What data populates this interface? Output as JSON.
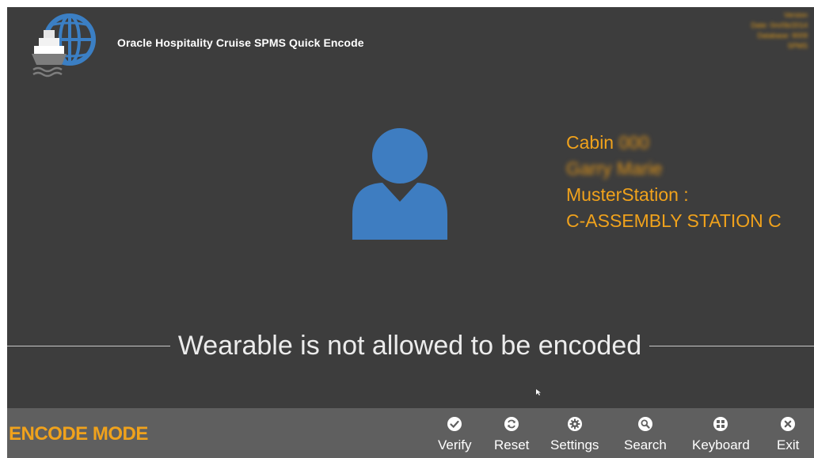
{
  "app": {
    "title": "Oracle Hospitality Cruise SPMS Quick Encode",
    "logo_icon": "globe-ship-icon"
  },
  "version_info": {
    "lines": [
      "Version",
      "Date: 0m/0b/2014",
      "Database: 9009",
      "SPMS"
    ]
  },
  "guest": {
    "avatar_icon": "person-icon",
    "cabin_label": "Cabin",
    "cabin_number": "000",
    "name": "Garry Marie",
    "muster_label": "MusterStation :",
    "muster_station": "C-ASSEMBLY STATION C"
  },
  "status": {
    "message": "Wearable is not allowed to be encoded"
  },
  "footer": {
    "mode_label": "ENCODE MODE",
    "tools": [
      {
        "label": "Verify",
        "icon": "check-circle-icon"
      },
      {
        "label": "Reset",
        "icon": "refresh-icon"
      },
      {
        "label": "Settings",
        "icon": "gear-icon"
      },
      {
        "label": "Search",
        "icon": "magnifier-icon"
      },
      {
        "label": "Keyboard",
        "icon": "keyboard-icon"
      },
      {
        "label": "Exit",
        "icon": "close-circle-icon"
      }
    ]
  },
  "colors": {
    "background": "#3d3d3d",
    "footer": "#5f5f5f",
    "accent_orange": "#f0a21c",
    "logo_blue": "#3b7fc4",
    "avatar_blue": "#3e7dc1"
  }
}
